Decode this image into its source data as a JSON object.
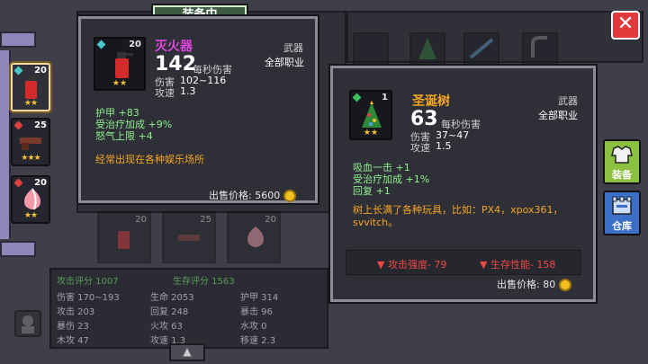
{
  "header": {
    "title": "装备中"
  },
  "close": {
    "label": "✕"
  },
  "right_buttons": [
    {
      "label": "装备",
      "icon": "armor-icon"
    },
    {
      "label": "仓库",
      "icon": "warehouse-icon"
    }
  ],
  "left_slots": [
    {
      "name": "extinguisher",
      "count": "20",
      "stars": "★★",
      "gem_color": "#49c9c9",
      "selected": true
    },
    {
      "name": "shotgun",
      "count": "25",
      "stars": "★★★",
      "gem_color": "#e04040",
      "selected": false
    },
    {
      "name": "peach",
      "count": "20",
      "stars": "★★",
      "gem_color": "#e04040",
      "selected": false
    }
  ],
  "popup_main": {
    "gem_color": "#49c9c9",
    "count": "20",
    "stars": "★★",
    "name": "灭火器",
    "name_color": "#e045e0",
    "dps": "142",
    "dps_label": "每秒伤害",
    "damage_label": "伤害",
    "damage": "102~116",
    "speed_label": "攻速",
    "speed": "1.3",
    "type": "武器",
    "class": "全部职业",
    "bonuses": [
      "护甲 +83",
      "受治疗加成 +9%",
      "怒气上限 +4"
    ],
    "description": "经常出现在各种娱乐场所",
    "price_label": "出售价格:",
    "price": "5600"
  },
  "popup_compare": {
    "gem_color": "#3cc060",
    "count": "1",
    "stars": "★★",
    "name": "圣诞树",
    "name_color": "#f5a623",
    "dps": "63",
    "dps_label": "每秒伤害",
    "damage_label": "伤害",
    "damage": "37~47",
    "speed_label": "攻速",
    "speed": "1.5",
    "type": "武器",
    "class": "全部职业",
    "bonuses": [
      "吸血一击 +1",
      "受治疗加成 +1%",
      "回复 +1"
    ],
    "description": "树上长满了各种玩具，比如：PX4，xpox361，svvitch。",
    "attack_delta": "▼ 攻击强度- 79",
    "survive_delta": "▼ 生存性能- 158",
    "price_label": "出售价格:",
    "price": "80"
  },
  "bottom_stats": {
    "attack_score": "攻击评分 1007",
    "survive_score": "生存评分 1563",
    "rows": [
      [
        "伤害 170~193",
        "生命 2053",
        "护甲 314"
      ],
      [
        "攻击 203",
        "回复 248",
        "暴击 96"
      ],
      [
        "暴伤 23",
        "火攻 63",
        "水攻 0"
      ],
      [
        "木攻 47",
        "攻速 1.3",
        "移速 2.3"
      ]
    ]
  },
  "bottom_slots": [
    {
      "count": "20",
      "stars": "★★"
    },
    {
      "count": "25",
      "stars": "★★★"
    },
    {
      "count": "20",
      "stars": "★★"
    }
  ]
}
